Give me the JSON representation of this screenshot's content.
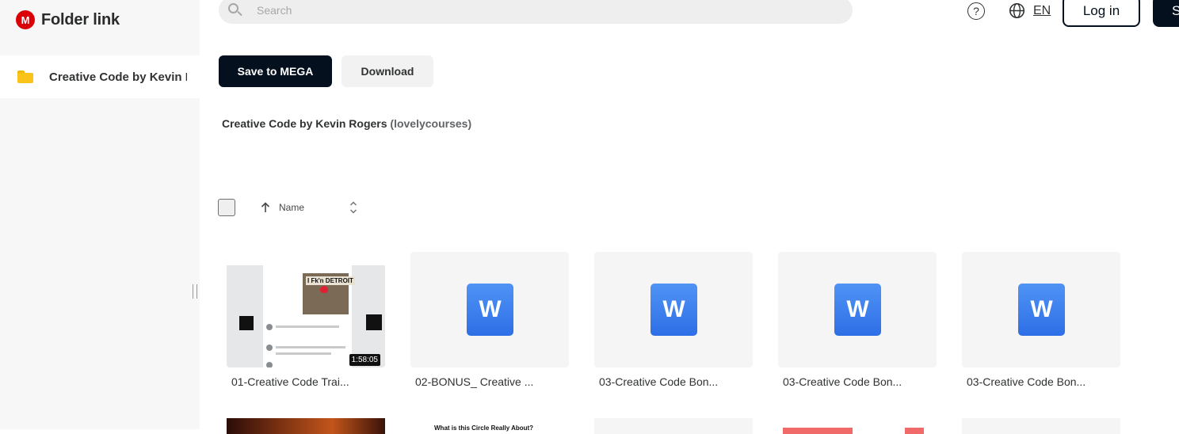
{
  "app": {
    "title": "Folder link",
    "logo_letter": "M"
  },
  "sidebar": {
    "items": [
      {
        "label": "Creative Code by Kevin Rogers"
      }
    ]
  },
  "search": {
    "placeholder": "Search"
  },
  "header": {
    "lang": "EN",
    "login_label": "Log in",
    "signup_label": "S"
  },
  "actions": {
    "save_label": "Save to MEGA",
    "download_label": "Download"
  },
  "folder": {
    "title": "Creative Code by Kevin Rogers",
    "owner": "(lovelycourses)"
  },
  "sort": {
    "label": "Name"
  },
  "files": [
    {
      "name": "01-Creative Code Trai...",
      "type": "video",
      "duration": "1:58:05",
      "poster_text": "I Fk'n DETROIT"
    },
    {
      "name": "02-BONUS_ Creative ...",
      "type": "word",
      "icon_letter": "W"
    },
    {
      "name": "03-Creative Code Bon...",
      "type": "word",
      "icon_letter": "W"
    },
    {
      "name": "03-Creative Code Bon...",
      "type": "word",
      "icon_letter": "W"
    },
    {
      "name": "03-Creative Code Bon...",
      "type": "word",
      "icon_letter": "W"
    }
  ],
  "next_row": {
    "partial_text": "What is this Circle Really About?"
  },
  "colors": {
    "brand": "#d90007",
    "primary_button": "#04101e",
    "folder": "#f9c31a",
    "word": "#3b7ff0"
  }
}
